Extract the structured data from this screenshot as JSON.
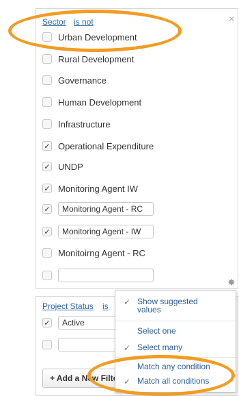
{
  "sector_filter": {
    "field_label": "Sector",
    "operator_label": "is not",
    "close_glyph": "×",
    "options": [
      {
        "label": "Urban Development",
        "checked": false
      },
      {
        "label": "Rural Development",
        "checked": false
      },
      {
        "label": "Governance",
        "checked": false
      },
      {
        "label": "Human Development",
        "checked": false
      },
      {
        "label": "Infrastructure",
        "checked": false
      },
      {
        "label": "Operational Expenditure",
        "checked": true
      },
      {
        "label": "UNDP",
        "checked": true
      },
      {
        "label": "Monitoring Agent IW",
        "checked": true
      },
      {
        "label": "Monitoring Agent - RC",
        "checked": true,
        "editable": true
      },
      {
        "label": "Monitoring Agent - IW",
        "checked": true,
        "editable": true
      },
      {
        "label": "Monitoirng Agent - RC",
        "checked": false
      }
    ],
    "new_value": "",
    "settings_icon": "gear-icon"
  },
  "status_filter": {
    "field_label": "Project Status",
    "operator_label": "is",
    "options": [
      {
        "label": "Active",
        "checked": true,
        "editable": true
      }
    ],
    "new_value": ""
  },
  "add_filter_label": "+ Add a New Filter",
  "settings_menu": {
    "items": [
      {
        "label": "Show suggested values",
        "checked": true
      },
      {
        "label": "Select one",
        "checked": false
      },
      {
        "label": "Select many",
        "checked": true
      },
      {
        "label": "Match any condition",
        "checked": false
      },
      {
        "label": "Match all conditions",
        "checked": true
      }
    ]
  },
  "colors": {
    "link": "#2c67a6",
    "highlight": "#f39c22",
    "menu_text": "#2c5f99"
  },
  "check_glyph": "✓"
}
